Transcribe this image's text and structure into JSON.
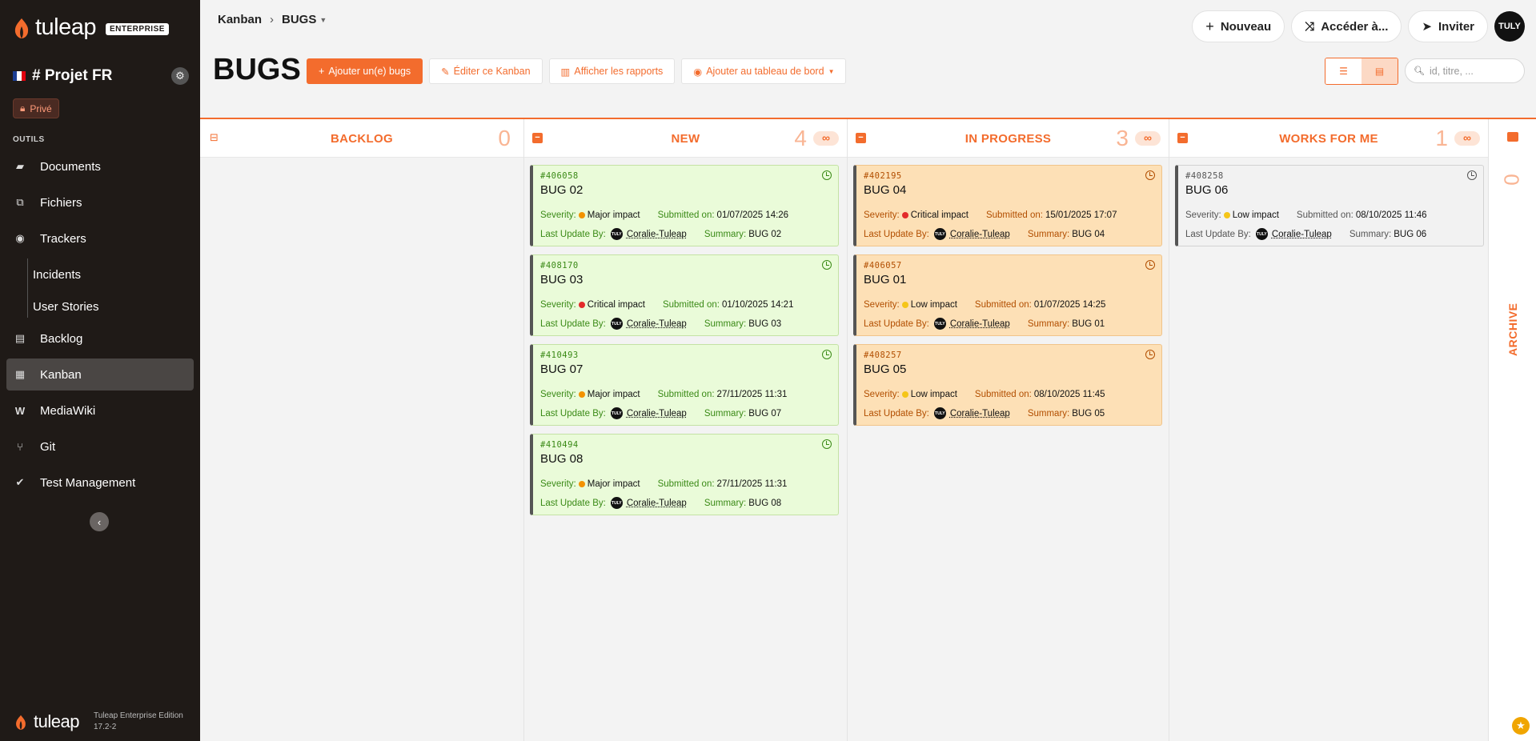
{
  "brand": {
    "name": "tuleap",
    "edition_badge": "ENTERPRISE",
    "accent": "#f36c2d",
    "sidebar_bg": "#1f1a17"
  },
  "sidebar": {
    "project_name": "# Projet FR",
    "privacy": "Privé",
    "section_label": "OUTILS",
    "items": [
      {
        "label": "Documents",
        "icon": "folder-icon"
      },
      {
        "label": "Fichiers",
        "icon": "files-icon"
      },
      {
        "label": "Trackers",
        "icon": "trackers-icon"
      },
      {
        "label": "Incidents",
        "icon": ""
      },
      {
        "label": "User Stories",
        "icon": ""
      },
      {
        "label": "Backlog",
        "icon": "backlog-icon"
      },
      {
        "label": "Kanban",
        "icon": "kanban-icon",
        "active": true
      },
      {
        "label": "MediaWiki",
        "icon": "mediawiki-icon"
      },
      {
        "label": "Git",
        "icon": "git-icon"
      },
      {
        "label": "Test Management",
        "icon": "test-management-icon"
      }
    ],
    "footer_logo": "tuleap",
    "footer_edition": "Tuleap Enterprise Edition",
    "footer_version": "17.2-2"
  },
  "header": {
    "breadcrumb": [
      "Kanban",
      "BUGS"
    ],
    "buttons": {
      "new": "Nouveau",
      "goto": "Accéder à...",
      "invite": "Inviter"
    },
    "avatar": "TULY"
  },
  "kanban": {
    "title": "BUGS",
    "add_button": "Ajouter un(e) bugs",
    "edit_button": "Éditer ce Kanban",
    "reports_button": "Afficher les rapports",
    "dashboard_button": "Ajouter au tableau de bord",
    "filter_placeholder": "id, titre, ...",
    "labels": {
      "severity": "Severity:",
      "submitted": "Submitted on:",
      "last_update": "Last Update By:",
      "summary": "Summary:"
    },
    "columns": [
      {
        "title": "BACKLOG",
        "count": "0",
        "cards": []
      },
      {
        "title": "NEW",
        "count": "4",
        "wip": "∞",
        "cards": [
          {
            "id": "#406058",
            "title": "BUG 02",
            "severity": "Major impact",
            "severity_color": "#f39200",
            "submitted": "01/07/2025 14:26",
            "user": "Coralie-Tuleap",
            "summary": "BUG 02"
          },
          {
            "id": "#408170",
            "title": "BUG 03",
            "severity": "Critical impact",
            "severity_color": "#e32b2b",
            "submitted": "01/10/2025 14:21",
            "user": "Coralie-Tuleap",
            "summary": "BUG 03"
          },
          {
            "id": "#410493",
            "title": "BUG 07",
            "severity": "Major impact",
            "severity_color": "#f39200",
            "submitted": "27/11/2025 11:31",
            "user": "Coralie-Tuleap",
            "summary": "BUG 07"
          },
          {
            "id": "#410494",
            "title": "BUG 08",
            "severity": "Major impact",
            "severity_color": "#f39200",
            "submitted": "27/11/2025 11:31",
            "user": "Coralie-Tuleap",
            "summary": "BUG 08"
          }
        ]
      },
      {
        "title": "IN PROGRESS",
        "count": "3",
        "wip": "∞",
        "cards": [
          {
            "id": "#402195",
            "title": "BUG 04",
            "severity": "Critical impact",
            "severity_color": "#e32b2b",
            "submitted": "15/01/2025 17:07",
            "user": "Coralie-Tuleap",
            "summary": "BUG 04"
          },
          {
            "id": "#406057",
            "title": "BUG 01",
            "severity": "Low impact",
            "severity_color": "#f5c518",
            "submitted": "01/07/2025 14:25",
            "user": "Coralie-Tuleap",
            "summary": "BUG 01"
          },
          {
            "id": "#408257",
            "title": "BUG 05",
            "severity": "Low impact",
            "severity_color": "#f5c518",
            "submitted": "08/10/2025 11:45",
            "user": "Coralie-Tuleap",
            "summary": "BUG 05"
          }
        ]
      },
      {
        "title": "WORKS FOR ME",
        "count": "1",
        "wip": "∞",
        "cards": [
          {
            "id": "#408258",
            "title": "BUG 06",
            "severity": "Low impact",
            "severity_color": "#f5c518",
            "submitted": "08/10/2025 11:46",
            "user": "Coralie-Tuleap",
            "summary": "BUG 06"
          }
        ]
      }
    ],
    "archive": {
      "title": "ARCHIVE",
      "count": "0"
    }
  }
}
